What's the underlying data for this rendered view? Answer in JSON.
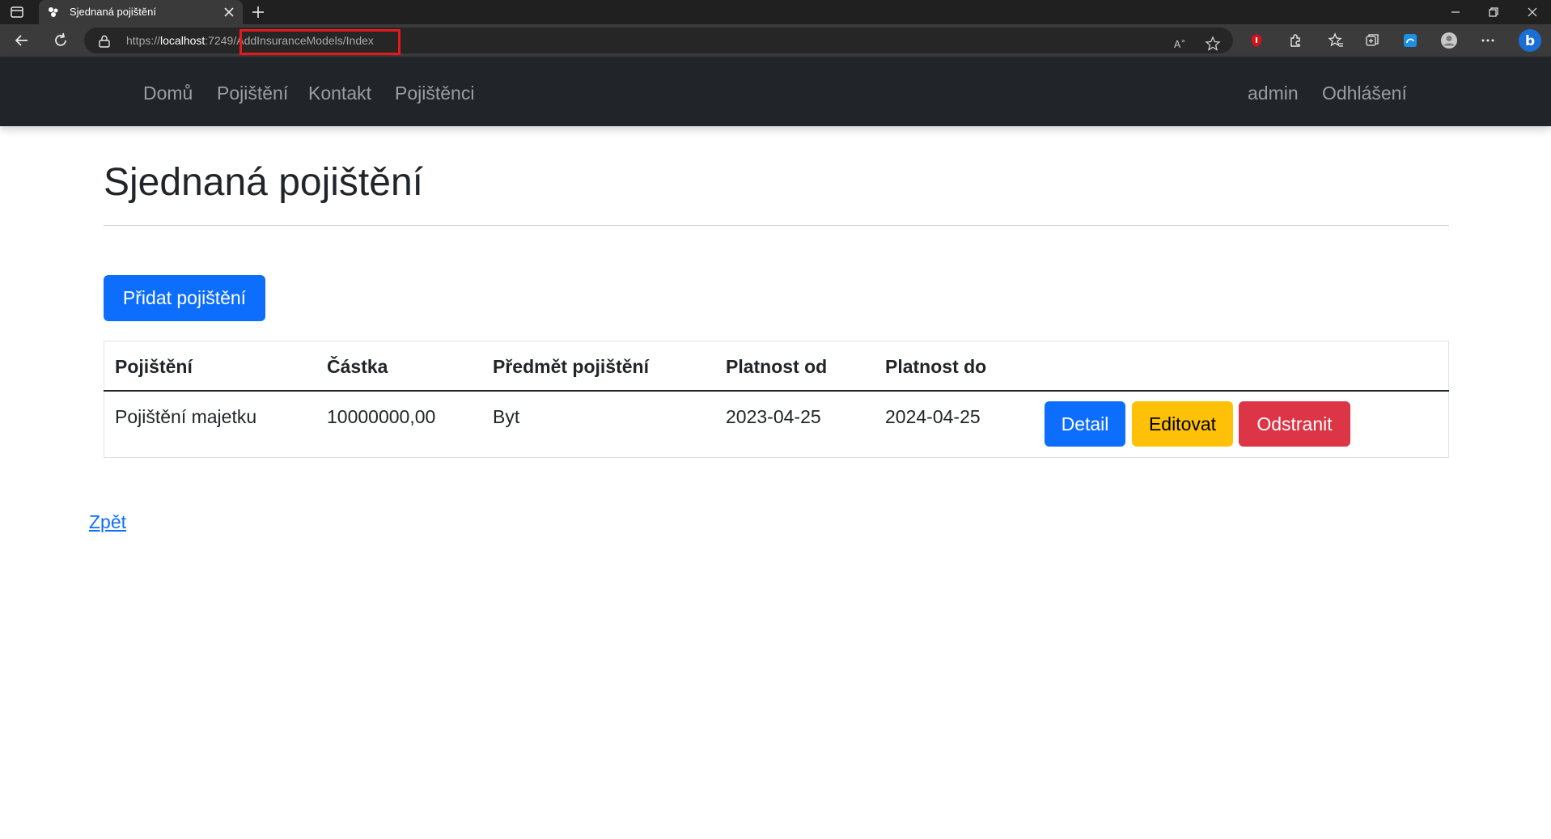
{
  "browser": {
    "tab_title": "Sjednaná pojištění",
    "url_scheme": "https://",
    "url_host": "localhost",
    "url_port": ":7249",
    "url_path": "/AddInsuranceModels/Index",
    "highlight_color": "#e8191c"
  },
  "navbar": {
    "links": [
      "Domů",
      "Pojištění",
      "Kontakt",
      "Pojištěnci"
    ],
    "user": "admin",
    "logout": "Odhlášení"
  },
  "page": {
    "title": "Sjednaná pojištění",
    "add_button": "Přidat pojištění",
    "back_link": "Zpět"
  },
  "table": {
    "headers": [
      "Pojištění",
      "Částka",
      "Předmět pojištění",
      "Platnost od",
      "Platnost do"
    ],
    "rows": [
      {
        "insurance": "Pojištění majetku",
        "amount": "10000000,00",
        "subject": "Byt",
        "valid_from": "2023-04-25",
        "valid_to": "2024-04-25",
        "actions": {
          "detail": "Detail",
          "edit": "Editovat",
          "delete": "Odstranit"
        }
      }
    ]
  },
  "colors": {
    "primary": "#0d6efd",
    "warning": "#ffc107",
    "danger": "#dc3545",
    "navbar": "#212529"
  },
  "icons": {
    "tab_toggle": "tab-actions-icon",
    "favicon": "app-favicon-icon",
    "close": "close-icon",
    "new_tab": "plus-icon",
    "back": "back-arrow-icon",
    "reload": "reload-icon",
    "lock": "lock-icon"
  }
}
